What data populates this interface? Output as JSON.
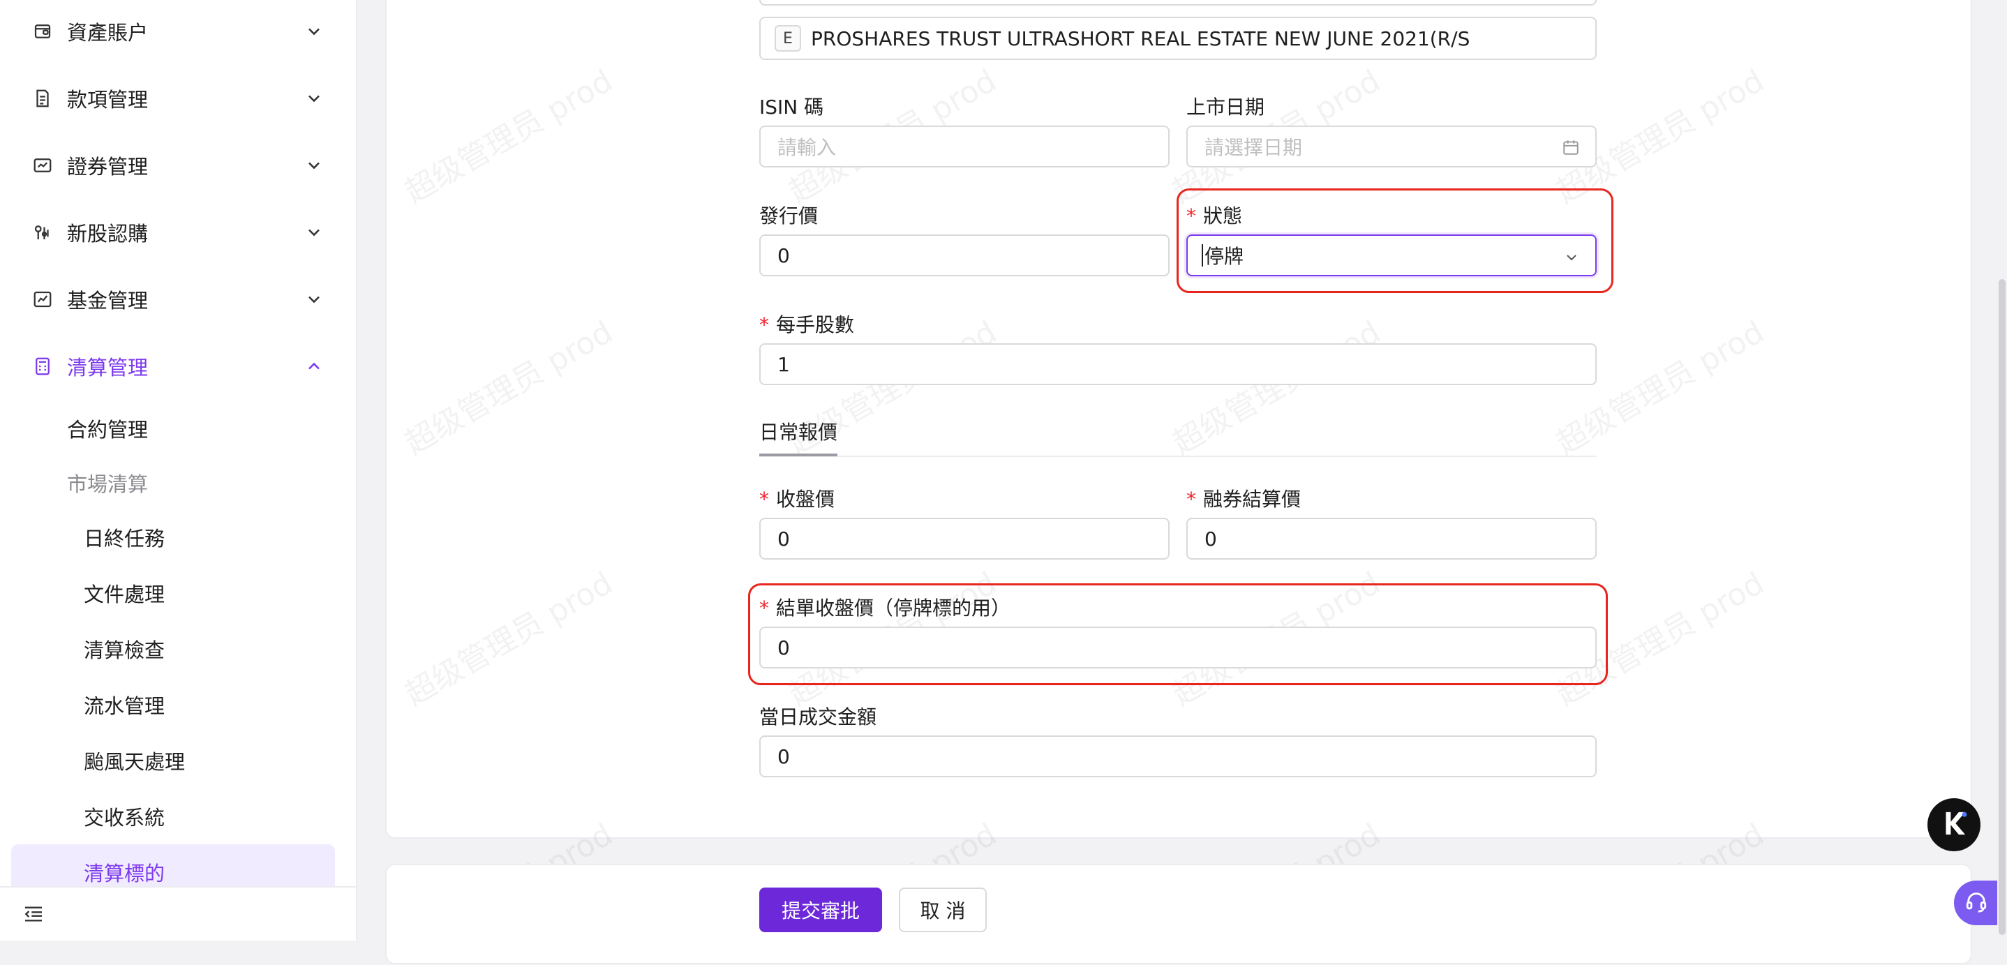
{
  "sidebar": {
    "menu": [
      {
        "label": "資產賬户",
        "icon": "wallet-icon",
        "expanded": false
      },
      {
        "label": "款項管理",
        "icon": "receipt-icon",
        "expanded": false
      },
      {
        "label": "證券管理",
        "icon": "securities-icon",
        "expanded": false
      },
      {
        "label": "新股認購",
        "icon": "ipo-icon",
        "expanded": false
      },
      {
        "label": "基金管理",
        "icon": "chart-line-icon",
        "expanded": false
      },
      {
        "label": "清算管理",
        "icon": "calculator-icon",
        "expanded": true
      }
    ],
    "sub_items": {
      "contract": "合約管理",
      "market_clearing": "市場清算",
      "eod_tasks": "日終任務",
      "file_processing": "文件處理",
      "clearing_check": "清算檢查",
      "journal": "流水管理",
      "typhoon": "颱風天處理",
      "settlement_system": "交收系統",
      "clearing_target": "清算標的"
    }
  },
  "form": {
    "security_name": {
      "tag": "E",
      "value": "PROSHARES TRUST ULTRASHORT REAL ESTATE NEW JUNE 2021(R/S"
    },
    "isin": {
      "label": "ISIN 碼",
      "placeholder": "請輸入"
    },
    "listing_date": {
      "label": "上市日期",
      "placeholder": "請選擇日期"
    },
    "issue_price": {
      "label": "發行價",
      "value": "0"
    },
    "status": {
      "label": "狀態",
      "value": "停牌",
      "required": true
    },
    "lot_size": {
      "label": "每手股數",
      "value": "1",
      "required": true
    },
    "daily_quote_section": "日常報價",
    "closing_price": {
      "label": "收盤價",
      "value": "0",
      "required": true
    },
    "margin_settlement_price": {
      "label": "融券結算價",
      "value": "0",
      "required": true
    },
    "settlement_closing_price": {
      "label": "結單收盤價（停牌標的用）",
      "value": "0",
      "required": true
    },
    "daily_turnover": {
      "label": "當日成交金額",
      "value": "0"
    }
  },
  "actions": {
    "submit": "提交審批",
    "cancel": "取 消"
  },
  "watermark": "超级管理员 prod",
  "colors": {
    "accent": "#7c3aed",
    "primary_button": "#6d28d9",
    "required_star": "#f5222d",
    "highlight_box": "#e8261d"
  }
}
